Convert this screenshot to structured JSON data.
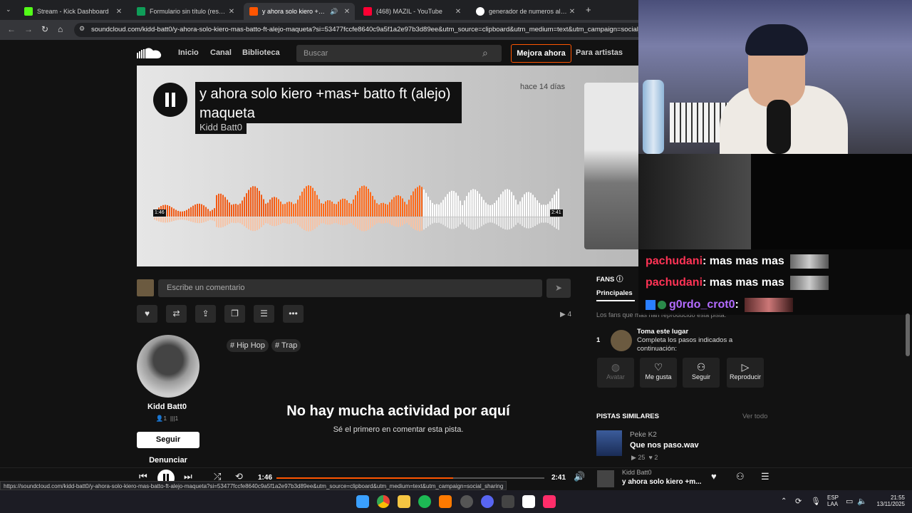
{
  "browser": {
    "tabs": [
      {
        "title": "Stream - Kick Dashboard",
        "icon_color": "#53fc18",
        "active": false
      },
      {
        "title": "Formulario sin título (respuesta",
        "icon_color": "#0f9d58",
        "active": false
      },
      {
        "title": "y ahora solo kiero +mas+ b",
        "icon_color": "#ff5500",
        "active": true
      },
      {
        "title": "(468) MAZIL - YouTube",
        "icon_color": "#ff0033",
        "active": false
      },
      {
        "title": "generador de numeros aleatori",
        "icon_color": "#ffffff",
        "active": false
      }
    ],
    "url": "soundcloud.com/kidd-batt0/y-ahora-solo-kiero-mas-batto-ft-alejo-maqueta?si=53477fccfe8640c9a5f1a2e97b3d89ee&utm_source=clipboard&utm_medium=text&utm_campaign=social_sharing",
    "status_url": "https://soundcloud.com/kidd-batt0/y-ahora-solo-kiero-mas-batto-ft-alejo-maqueta?si=53477fccfe8640c9a5f1a2e97b3d89ee&utm_source=clipboard&utm_medium=text&utm_campaign=social_sharing"
  },
  "nav": {
    "inicio": "Inicio",
    "canal": "Canal",
    "biblioteca": "Biblioteca",
    "search_placeholder": "Buscar",
    "upgrade": "Mejora ahora",
    "artists": "Para artistas"
  },
  "track": {
    "title": "y ahora solo kiero +mas+ batto ft (alejo) maqueta",
    "artist": "Kidd Batt0",
    "posted": "hace 14 días",
    "time_elapsed": "1:46",
    "time_total": "2:41",
    "progress": 0.66
  },
  "comment": {
    "placeholder": "Escribe un comentario",
    "plays": "4"
  },
  "artist": {
    "name": "Kidd Batt0",
    "followers": "1",
    "tracks": "1",
    "follow": "Seguir",
    "report": "Denunciar"
  },
  "tags": [
    "# Hip Hop",
    "# Trap"
  ],
  "activity": {
    "title": "No hay mucha actividad por aquí",
    "subtitle": "Sé el primero en comentar esta pista."
  },
  "fans": {
    "label": "FANS",
    "tab": "Principales",
    "desc": "Los fans que más han reproducido esta pista.",
    "rank": "1",
    "cta_title": "Toma este lugar",
    "cta_text": "Completa los pasos indicados a continuación:",
    "actions": [
      "Avatar",
      "Me gusta",
      "Seguir",
      "Reproducir"
    ]
  },
  "similar": {
    "label": "PISTAS SIMILARES",
    "see_all": "Ver todo",
    "artist": "Peke K2",
    "title": "Que nos paso.wav",
    "plays": "25",
    "likes": "2"
  },
  "chat": [
    {
      "user": "pachudani",
      "msg": ": mas mas mas",
      "color": "#ff3355"
    },
    {
      "user": "pachudani",
      "msg": ": mas mas mas",
      "color": "#ff3355"
    },
    {
      "user": "g0rdo_crot0",
      "msg": ":",
      "color": "#b36bff"
    }
  ],
  "player": {
    "elapsed": "1:46",
    "total": "2:41",
    "artist": "Kidd Batt0",
    "title": "y ahora solo kiero +m..."
  },
  "taskbar": {
    "lang1": "ESP",
    "lang2": "LAA",
    "time": "21:55",
    "date": "13/11/2025"
  }
}
